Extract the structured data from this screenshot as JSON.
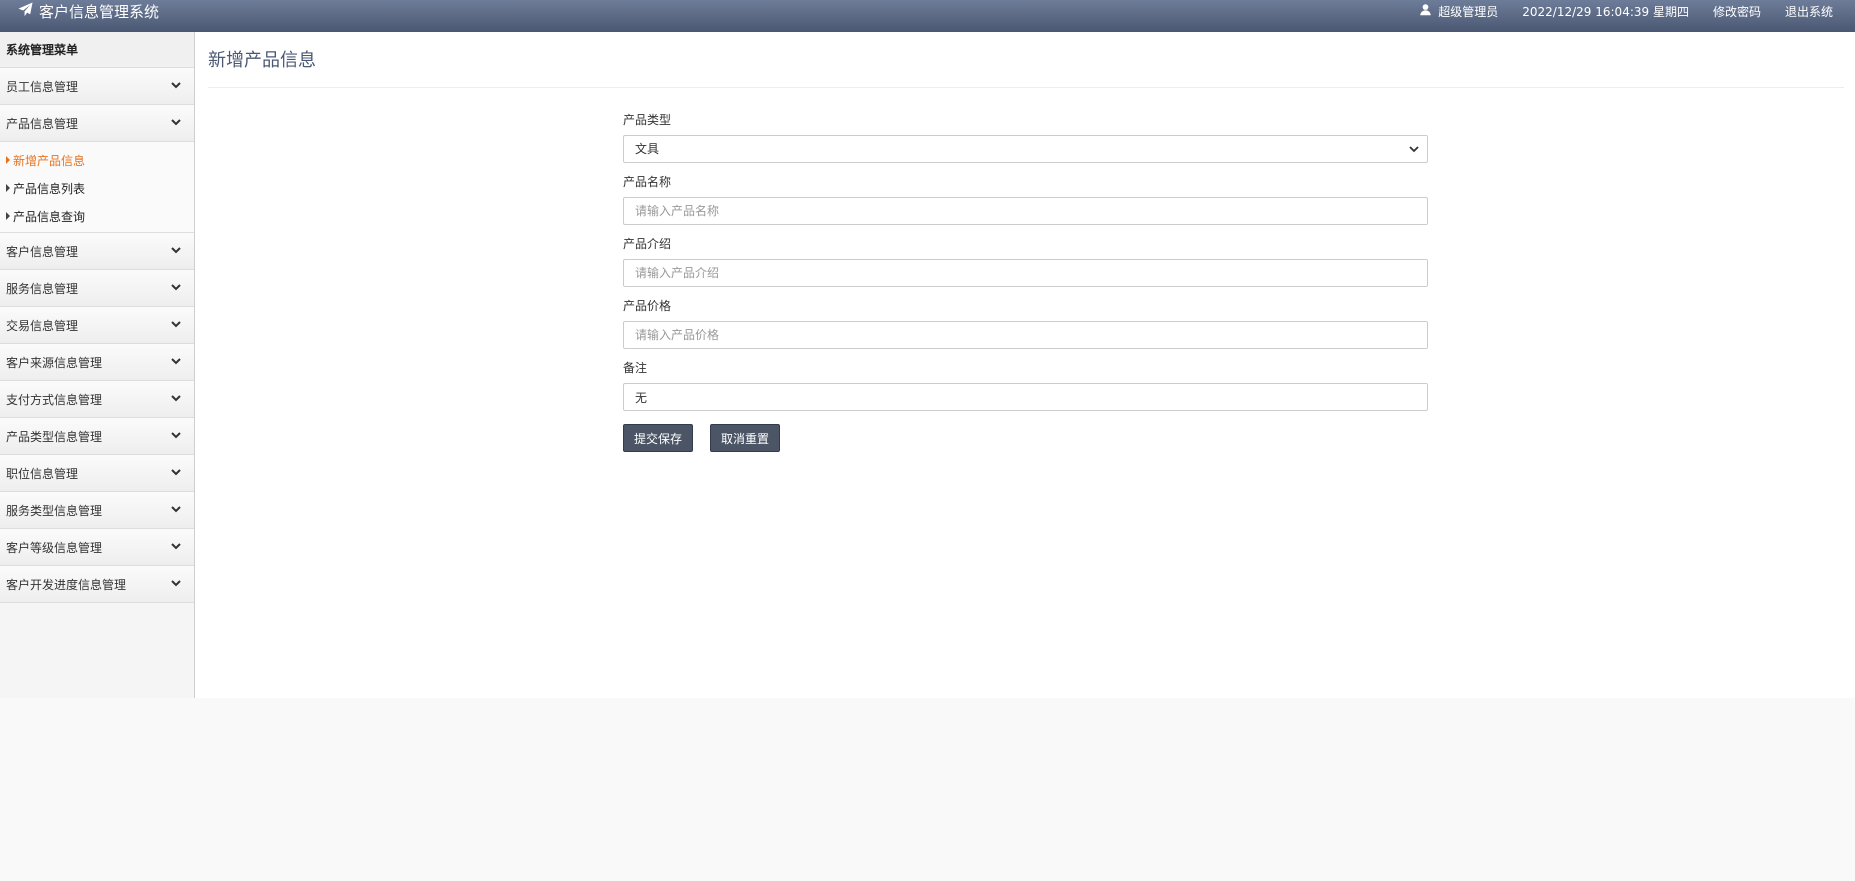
{
  "header": {
    "app_title": "客户信息管理系统",
    "user": "超级管理员",
    "datetime": "2022/12/29 16:04:39 星期四",
    "change_password": "修改密码",
    "logout": "退出系统"
  },
  "sidebar": {
    "title": "系统管理菜单",
    "groups": [
      {
        "label": "员工信息管理"
      },
      {
        "label": "产品信息管理",
        "children": [
          "新增产品信息",
          "产品信息列表",
          "产品信息查询"
        ]
      },
      {
        "label": "客户信息管理"
      },
      {
        "label": "服务信息管理"
      },
      {
        "label": "交易信息管理"
      },
      {
        "label": "客户来源信息管理"
      },
      {
        "label": "支付方式信息管理"
      },
      {
        "label": "产品类型信息管理"
      },
      {
        "label": "职位信息管理"
      },
      {
        "label": "服务类型信息管理"
      },
      {
        "label": "客户等级信息管理"
      },
      {
        "label": "客户开发进度信息管理"
      }
    ]
  },
  "main": {
    "title": "新增产品信息",
    "form": {
      "type_label": "产品类型",
      "type_value": "文具",
      "name_label": "产品名称",
      "name_placeholder": "请输入产品名称",
      "intro_label": "产品介绍",
      "intro_placeholder": "请输入产品介绍",
      "price_label": "产品价格",
      "price_placeholder": "请输入产品价格",
      "remark_label": "备注",
      "remark_value": "无",
      "submit_label": "提交保存",
      "reset_label": "取消重置"
    }
  },
  "colors": {
    "header_bg": "#5a6884",
    "active_menu": "#e8721e",
    "button_bg": "#4b5566"
  }
}
